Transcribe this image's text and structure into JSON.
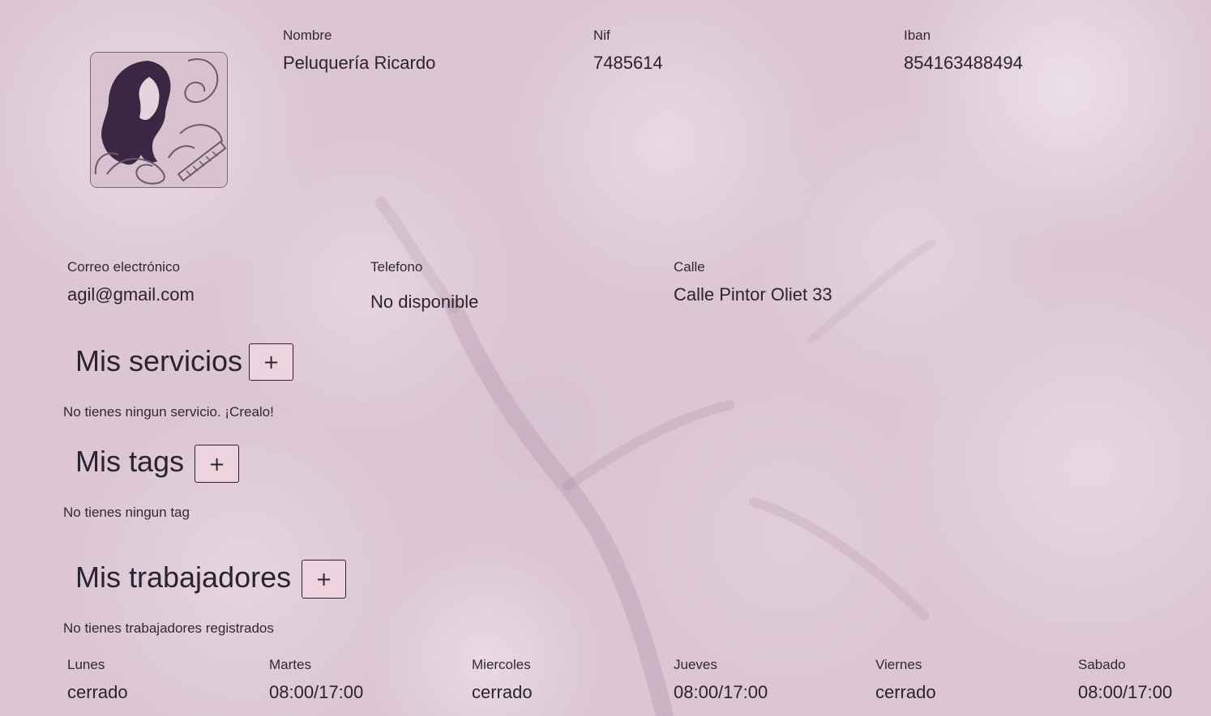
{
  "business": {
    "name_label": "Nombre",
    "name_value": "Peluquería Ricardo",
    "nif_label": "Nif",
    "nif_value": "7485614",
    "iban_label": "Iban",
    "iban_value": "854163488494",
    "email_label": "Correo electrónico",
    "email_value": "agil@gmail.com",
    "phone_label": "Telefono",
    "phone_value": "No disponible",
    "street_label": "Calle",
    "street_value": "Calle Pintor Oliet 33",
    "logo_icon": "salon-woman-logo-icon"
  },
  "services": {
    "title": "Mis servicios",
    "add_label": "+",
    "empty_message": "No tienes ningun servicio. ¡Crealo!"
  },
  "tags": {
    "title": "Mis tags",
    "add_label": "+",
    "empty_message": "No tienes ningun tag"
  },
  "workers": {
    "title": "Mis trabajadores",
    "add_label": "+",
    "empty_message": "No tienes trabajadores registrados"
  },
  "schedule": [
    {
      "day": "Lunes",
      "hours": "cerrado"
    },
    {
      "day": "Martes",
      "hours": "08:00/17:00"
    },
    {
      "day": "Miercoles",
      "hours": "cerrado"
    },
    {
      "day": "Jueves",
      "hours": "08:00/17:00"
    },
    {
      "day": "Viernes",
      "hours": "cerrado"
    },
    {
      "day": "Sabado",
      "hours": "08:00/17:00"
    }
  ],
  "colors": {
    "background": "#dfcbd8",
    "button_fill": "#ecd3de",
    "text": "#2a2430"
  }
}
